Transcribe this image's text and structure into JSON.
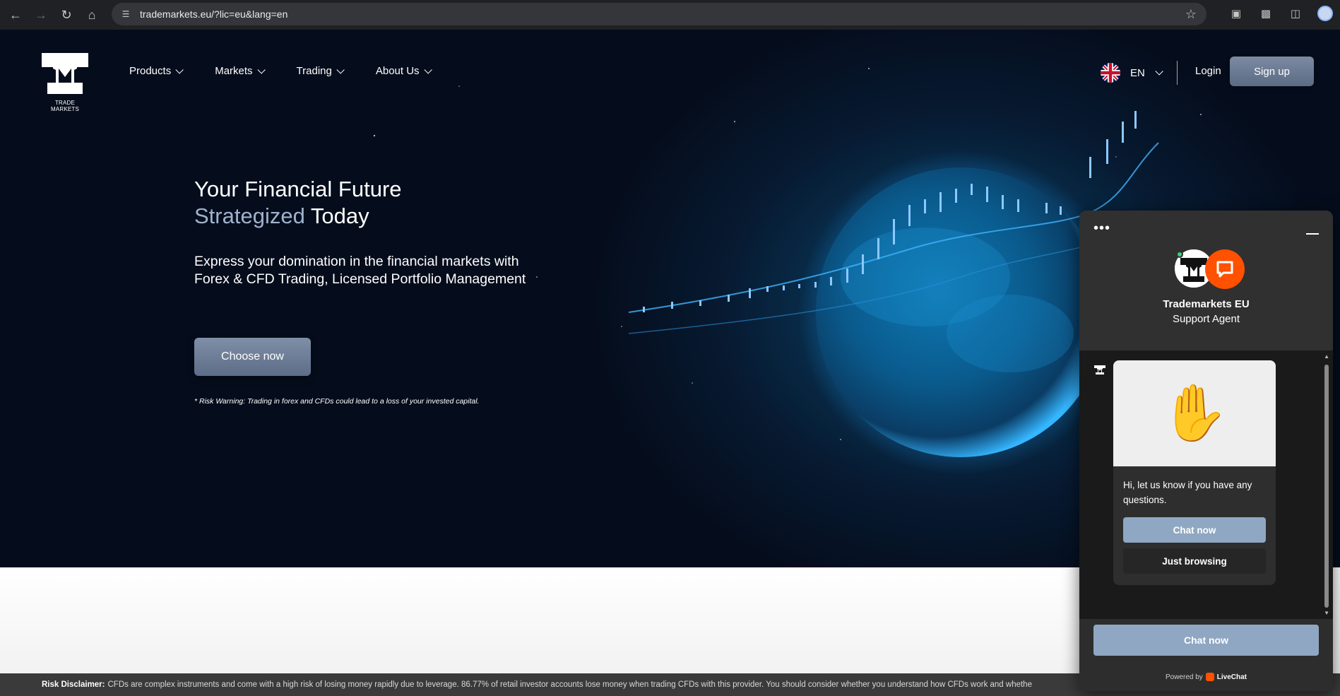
{
  "browser": {
    "url": "trademarkets.eu/?lic=eu&lang=en",
    "icons": [
      "back-icon",
      "forward-icon",
      "reload-icon",
      "home-icon",
      "site-settings-icon",
      "bookmark-star-icon",
      "extension-icon",
      "puzzle-icon",
      "sidebar-icon",
      "profile-avatar"
    ]
  },
  "nav": {
    "logo_text": "TRADE MARKETS",
    "items": [
      {
        "label": "Products"
      },
      {
        "label": "Markets"
      },
      {
        "label": "Trading"
      },
      {
        "label": "About Us"
      }
    ],
    "language": "EN",
    "login": "Login",
    "signup": "Sign up"
  },
  "hero": {
    "title_line1": "Your Financial Future",
    "title_accent": "Strategized",
    "title_rest": " Today",
    "subtitle": "Express your domination in the financial markets with Forex & CFD Trading, Licensed Portfolio Management",
    "cta": "Choose now",
    "risk_warning": "* Risk Warning: Trading in forex and CFDs could lead to a loss of your invested capital."
  },
  "disclaimer": {
    "label": "Risk Disclaimer:",
    "text": "CFDs are complex instruments and come with a high risk of losing money rapidly due to leverage. 86.77% of retail investor accounts lose money when trading CFDs with this provider. You should consider whether you understand how CFDs work and whethe"
  },
  "chat": {
    "menu_dots": "•••",
    "agent_name": "Trademarkets EU",
    "agent_role": "Support Agent",
    "greeting": "Hi, let us know if you have any questions.",
    "wave_emoji": "✋",
    "btn_chat_now": "Chat now",
    "btn_just_browsing": "Just browsing",
    "btn_chat_now_main": "Chat now",
    "powered_by": "Powered by",
    "brand": "LiveChat",
    "colors": {
      "accent": "#8fa7c2",
      "brand": "#ff5100"
    }
  }
}
